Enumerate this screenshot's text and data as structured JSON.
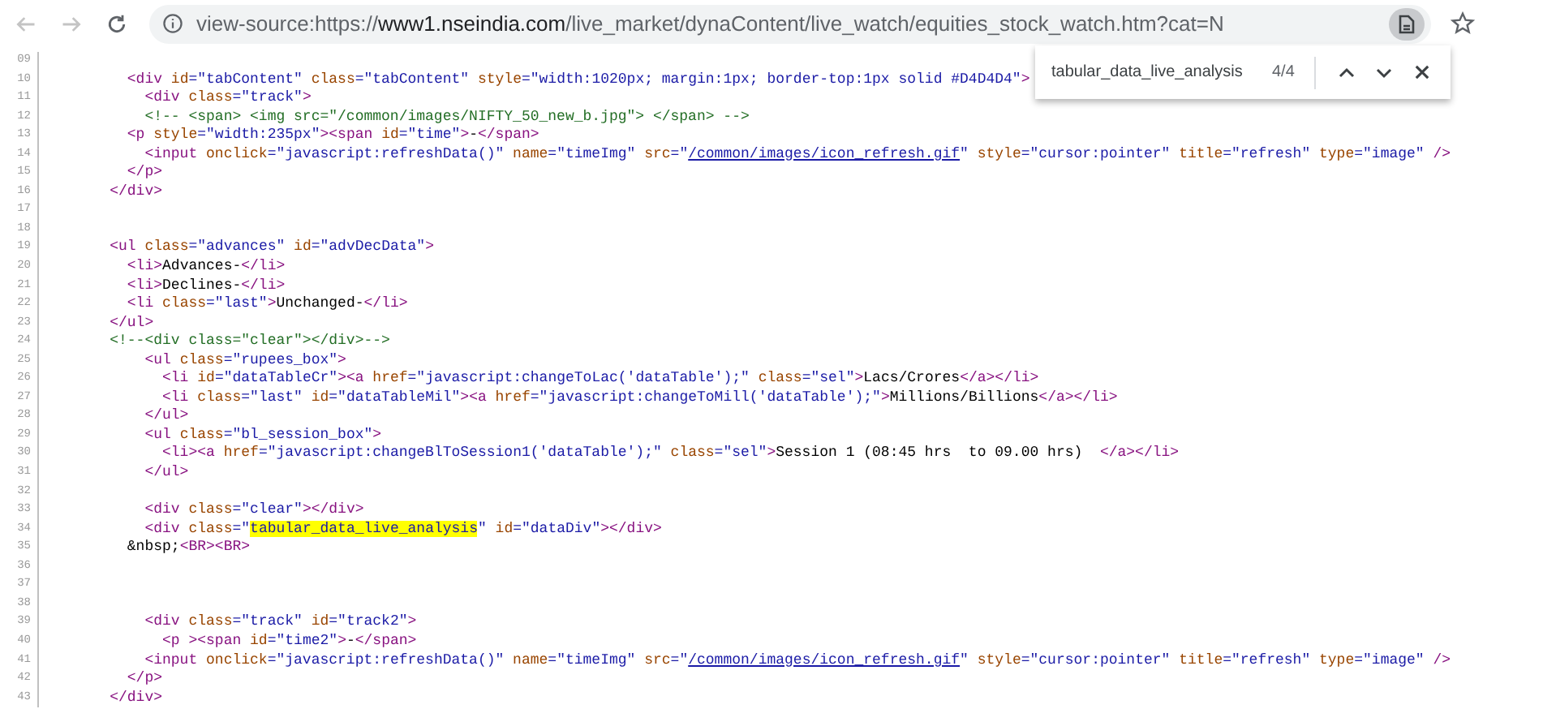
{
  "toolbar": {
    "back": {
      "disabled": true
    },
    "forward": {
      "disabled": true
    },
    "url": {
      "prefix": "view-source:https://",
      "domain": "www1.nseindia.com",
      "path": "/live_market/dynaContent/live_watch/equities_stock_watch.htm?cat=N"
    }
  },
  "find_bar": {
    "query": "tabular_data_live_analysis",
    "count": "4/4"
  },
  "lines": [
    {
      "number": "09"
    },
    {
      "number": "10",
      "tokens": [
        {
          "kind": "tag",
          "text": "      <div "
        },
        {
          "kind": "attr",
          "text": "id"
        },
        {
          "kind": "value",
          "text": "=\"tabContent\""
        },
        {
          "kind": "attr",
          "text": " class"
        },
        {
          "kind": "value",
          "text": "=\"tabContent\""
        },
        {
          "kind": "attr",
          "text": " style"
        },
        {
          "kind": "value",
          "text": "=\"width:1020px; margin:1px; border-top:1px solid #D4D4D4\""
        },
        {
          "kind": "tag",
          "text": ">"
        }
      ]
    },
    {
      "number": "11",
      "tokens": [
        {
          "kind": "tag",
          "text": "        <div "
        },
        {
          "kind": "attr",
          "text": "class"
        },
        {
          "kind": "value",
          "text": "=\"track\""
        },
        {
          "kind": "tag",
          "text": ">"
        }
      ]
    },
    {
      "number": "12",
      "tokens": [
        {
          "kind": "comment",
          "text": "        <!-- <span> <img src=\"/common/images/NIFTY_50_new_b.jpg\"> </span> -->"
        }
      ]
    },
    {
      "number": "13",
      "tokens": [
        {
          "kind": "tag",
          "text": "      <p "
        },
        {
          "kind": "attr",
          "text": "style"
        },
        {
          "kind": "value",
          "text": "=\"width:235px\""
        },
        {
          "kind": "tag",
          "text": "><span "
        },
        {
          "kind": "attr",
          "text": "id"
        },
        {
          "kind": "value",
          "text": "=\"time\""
        },
        {
          "kind": "tag",
          "text": ">"
        },
        {
          "kind": "text",
          "text": "-"
        },
        {
          "kind": "tag",
          "text": "</span>"
        }
      ]
    },
    {
      "number": "14",
      "tokens": [
        {
          "kind": "tag",
          "text": "        <input "
        },
        {
          "kind": "attr",
          "text": "onclick"
        },
        {
          "kind": "value",
          "text": "=\"javascript:refreshData()\""
        },
        {
          "kind": "attr",
          "text": " name"
        },
        {
          "kind": "value",
          "text": "=\"timeImg\""
        },
        {
          "kind": "attr",
          "text": " src"
        },
        {
          "kind": "value",
          "text": "=\""
        },
        {
          "kind": "link",
          "text": "/common/images/icon_refresh.gif"
        },
        {
          "kind": "value",
          "text": "\""
        },
        {
          "kind": "attr",
          "text": " style"
        },
        {
          "kind": "value",
          "text": "=\"cursor:pointer\""
        },
        {
          "kind": "attr",
          "text": " title"
        },
        {
          "kind": "value",
          "text": "=\"refresh\""
        },
        {
          "kind": "attr",
          "text": " type"
        },
        {
          "kind": "value",
          "text": "=\"image\""
        },
        {
          "kind": "tag",
          "text": " />"
        }
      ]
    },
    {
      "number": "15",
      "tokens": [
        {
          "kind": "tag",
          "text": "      </p>"
        }
      ]
    },
    {
      "number": "16",
      "tokens": [
        {
          "kind": "tag",
          "text": "    </div>"
        }
      ]
    },
    {
      "number": "17"
    },
    {
      "number": "18"
    },
    {
      "number": "19",
      "tokens": [
        {
          "kind": "tag",
          "text": "    <ul "
        },
        {
          "kind": "attr",
          "text": "class"
        },
        {
          "kind": "value",
          "text": "=\"advances\""
        },
        {
          "kind": "attr",
          "text": " id"
        },
        {
          "kind": "value",
          "text": "=\"advDecData\""
        },
        {
          "kind": "tag",
          "text": ">"
        }
      ]
    },
    {
      "number": "20",
      "tokens": [
        {
          "kind": "tag",
          "text": "      <li>"
        },
        {
          "kind": "text",
          "text": "Advances-"
        },
        {
          "kind": "tag",
          "text": "</li>"
        }
      ]
    },
    {
      "number": "21",
      "tokens": [
        {
          "kind": "tag",
          "text": "      <li>"
        },
        {
          "kind": "text",
          "text": "Declines-"
        },
        {
          "kind": "tag",
          "text": "</li>"
        }
      ]
    },
    {
      "number": "22",
      "tokens": [
        {
          "kind": "tag",
          "text": "      <li "
        },
        {
          "kind": "attr",
          "text": "class"
        },
        {
          "kind": "value",
          "text": "=\"last\""
        },
        {
          "kind": "tag",
          "text": ">"
        },
        {
          "kind": "text",
          "text": "Unchanged-"
        },
        {
          "kind": "tag",
          "text": "</li>"
        }
      ]
    },
    {
      "number": "23",
      "tokens": [
        {
          "kind": "tag",
          "text": "    </ul>"
        }
      ]
    },
    {
      "number": "24",
      "tokens": [
        {
          "kind": "comment",
          "text": "    <!--<div class=\"clear\"></div>-->"
        }
      ]
    },
    {
      "number": "25",
      "tokens": [
        {
          "kind": "tag",
          "text": "        <ul "
        },
        {
          "kind": "attr",
          "text": "class"
        },
        {
          "kind": "value",
          "text": "=\"rupees_box\""
        },
        {
          "kind": "tag",
          "text": ">"
        }
      ]
    },
    {
      "number": "26",
      "tokens": [
        {
          "kind": "tag",
          "text": "          <li "
        },
        {
          "kind": "attr",
          "text": "id"
        },
        {
          "kind": "value",
          "text": "=\"dataTableCr\""
        },
        {
          "kind": "tag",
          "text": "><a "
        },
        {
          "kind": "attr",
          "text": "href"
        },
        {
          "kind": "value",
          "text": "=\"javascript:changeToLac('dataTable');\""
        },
        {
          "kind": "attr",
          "text": " class"
        },
        {
          "kind": "value",
          "text": "=\"sel\""
        },
        {
          "kind": "tag",
          "text": ">"
        },
        {
          "kind": "text",
          "text": "Lacs/Crores"
        },
        {
          "kind": "tag",
          "text": "</a></li>"
        }
      ]
    },
    {
      "number": "27",
      "tokens": [
        {
          "kind": "tag",
          "text": "          <li "
        },
        {
          "kind": "attr",
          "text": "class"
        },
        {
          "kind": "value",
          "text": "=\"last\""
        },
        {
          "kind": "attr",
          "text": " id"
        },
        {
          "kind": "value",
          "text": "=\"dataTableMil\""
        },
        {
          "kind": "tag",
          "text": "><a "
        },
        {
          "kind": "attr",
          "text": "href"
        },
        {
          "kind": "value",
          "text": "=\"javascript:changeToMill('dataTable');\""
        },
        {
          "kind": "tag",
          "text": ">"
        },
        {
          "kind": "text",
          "text": "Millions/Billions"
        },
        {
          "kind": "tag",
          "text": "</a></li>"
        }
      ]
    },
    {
      "number": "28",
      "tokens": [
        {
          "kind": "tag",
          "text": "        </ul>"
        }
      ]
    },
    {
      "number": "29",
      "tokens": [
        {
          "kind": "tag",
          "text": "        <ul "
        },
        {
          "kind": "attr",
          "text": "class"
        },
        {
          "kind": "value",
          "text": "=\"bl_session_box\""
        },
        {
          "kind": "tag",
          "text": ">"
        }
      ]
    },
    {
      "number": "30",
      "tokens": [
        {
          "kind": "tag",
          "text": "          <li><a "
        },
        {
          "kind": "attr",
          "text": "href"
        },
        {
          "kind": "value",
          "text": "=\"javascript:changeBlToSession1('dataTable');\""
        },
        {
          "kind": "attr",
          "text": " class"
        },
        {
          "kind": "value",
          "text": "=\"sel\""
        },
        {
          "kind": "tag",
          "text": ">"
        },
        {
          "kind": "text",
          "text": "Session 1 (08:45 hrs  to 09.00 hrs)  "
        },
        {
          "kind": "tag",
          "text": "</a></li>"
        }
      ]
    },
    {
      "number": "31",
      "tokens": [
        {
          "kind": "tag",
          "text": "        </ul>"
        }
      ]
    },
    {
      "number": "32"
    },
    {
      "number": "33",
      "tokens": [
        {
          "kind": "tag",
          "text": "        <div "
        },
        {
          "kind": "attr",
          "text": "class"
        },
        {
          "kind": "value",
          "text": "=\"clear\""
        },
        {
          "kind": "tag",
          "text": "></div>"
        }
      ]
    },
    {
      "number": "34",
      "tokens": [
        {
          "kind": "tag",
          "text": "        <div "
        },
        {
          "kind": "attr",
          "text": "class"
        },
        {
          "kind": "value",
          "text": "=\""
        },
        {
          "kind": "match",
          "text": "tabular_data_live_analysis"
        },
        {
          "kind": "value",
          "text": "\""
        },
        {
          "kind": "attr",
          "text": " id"
        },
        {
          "kind": "value",
          "text": "=\"dataDiv\""
        },
        {
          "kind": "tag",
          "text": "></div>"
        }
      ]
    },
    {
      "number": "35",
      "tokens": [
        {
          "kind": "text",
          "text": "      &nbsp;"
        },
        {
          "kind": "tag",
          "text": "<BR><BR>"
        }
      ]
    },
    {
      "number": "36"
    },
    {
      "number": "37"
    },
    {
      "number": "38"
    },
    {
      "number": "39",
      "tokens": [
        {
          "kind": "tag",
          "text": "        <div "
        },
        {
          "kind": "attr",
          "text": "class"
        },
        {
          "kind": "value",
          "text": "=\"track\""
        },
        {
          "kind": "attr",
          "text": " id"
        },
        {
          "kind": "value",
          "text": "=\"track2\""
        },
        {
          "kind": "tag",
          "text": ">"
        }
      ]
    },
    {
      "number": "40",
      "tokens": [
        {
          "kind": "tag",
          "text": "          <p ><span "
        },
        {
          "kind": "attr",
          "text": "id"
        },
        {
          "kind": "value",
          "text": "=\"time2\""
        },
        {
          "kind": "tag",
          "text": ">"
        },
        {
          "kind": "text",
          "text": "-"
        },
        {
          "kind": "tag",
          "text": "</span>"
        }
      ]
    },
    {
      "number": "41",
      "tokens": [
        {
          "kind": "tag",
          "text": "        <input "
        },
        {
          "kind": "attr",
          "text": "onclick"
        },
        {
          "kind": "value",
          "text": "=\"javascript:refreshData()\""
        },
        {
          "kind": "attr",
          "text": " name"
        },
        {
          "kind": "value",
          "text": "=\"timeImg\""
        },
        {
          "kind": "attr",
          "text": " src"
        },
        {
          "kind": "value",
          "text": "=\""
        },
        {
          "kind": "link",
          "text": "/common/images/icon_refresh.gif"
        },
        {
          "kind": "value",
          "text": "\""
        },
        {
          "kind": "attr",
          "text": " style"
        },
        {
          "kind": "value",
          "text": "=\"cursor:pointer\""
        },
        {
          "kind": "attr",
          "text": " title"
        },
        {
          "kind": "value",
          "text": "=\"refresh\""
        },
        {
          "kind": "attr",
          "text": " type"
        },
        {
          "kind": "value",
          "text": "=\"image\""
        },
        {
          "kind": "tag",
          "text": " />"
        }
      ]
    },
    {
      "number": "42",
      "tokens": [
        {
          "kind": "tag",
          "text": "      </p>"
        }
      ]
    },
    {
      "number": "43",
      "tokens": [
        {
          "kind": "tag",
          "text": "    </div>"
        }
      ]
    }
  ]
}
